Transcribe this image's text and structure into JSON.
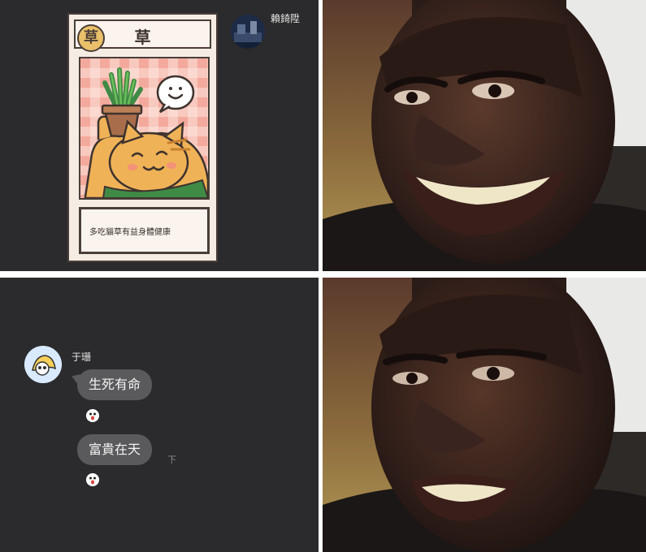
{
  "card": {
    "badge": "草",
    "title": "草",
    "description": "多吃貓草有益身體健康"
  },
  "top_chat": {
    "sender_name": "賴錡陞"
  },
  "chat": {
    "sender_name": "于珊",
    "messages": [
      {
        "text": "生死有命"
      },
      {
        "text": "富貴在天"
      }
    ],
    "time_fragment": "下"
  },
  "colors": {
    "panel_bg": "#2b2b2d",
    "bubble_bg": "#5a5a5c",
    "card_border": "#4a3e38",
    "card_pink": "#f6b3a9",
    "cat_orange": "#f0b257"
  }
}
